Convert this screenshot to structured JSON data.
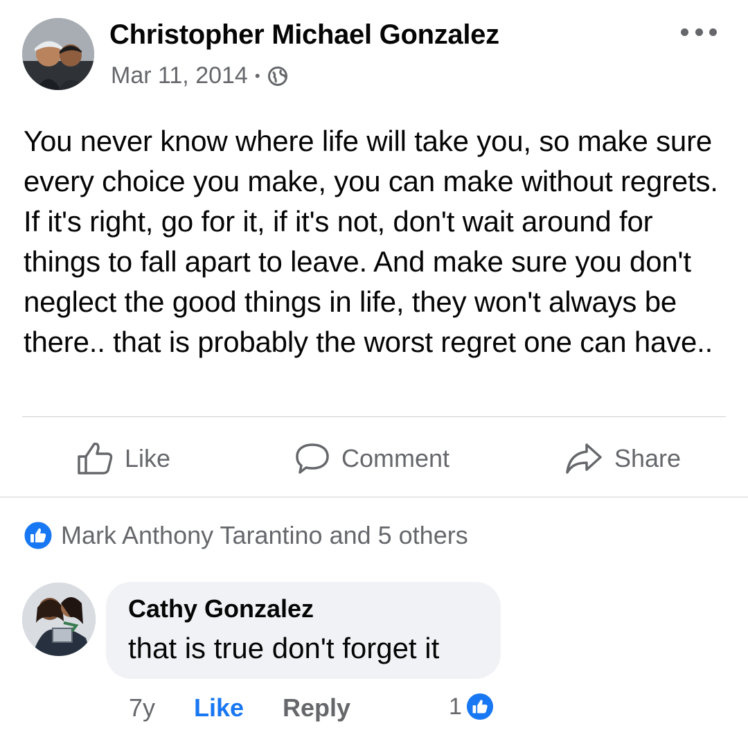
{
  "post": {
    "author": "Christopher Michael Gonzalez",
    "date": "Mar 11, 2014",
    "separator": "•",
    "privacy_icon": "globe-icon",
    "text": "You never know where life will take you, so make sure every choice you make, you can make without regrets. If it's right, go for it, if it's not, don't wait around for things to fall apart to leave. And make sure you don't neglect the good things in life, they won't always be there.. that is probably the worst regret one can have..",
    "more_icon": "more-options-icon"
  },
  "actions": {
    "like_label": "Like",
    "comment_label": "Comment",
    "share_label": "Share"
  },
  "reactions": {
    "summary": "Mark Anthony Tarantino and 5 others",
    "icon": "like-reaction-icon"
  },
  "comment": {
    "author": "Cathy Gonzalez",
    "text": "that is true don't forget it",
    "time": "7y",
    "like_label": "Like",
    "reply_label": "Reply",
    "reaction_count": "1"
  },
  "colors": {
    "accent": "#1877f2",
    "secondary_text": "#65676b",
    "bubble": "#f0f2f5"
  }
}
